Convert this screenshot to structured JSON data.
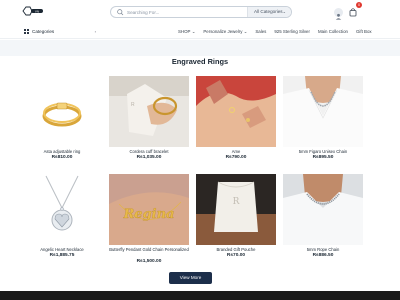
{
  "header": {
    "logo_text": "VN",
    "search": {
      "placeholder": "Searching For...",
      "category_label": "All Categories"
    },
    "cart_count": "0"
  },
  "nav": {
    "categories_label": "Categories",
    "links": [
      {
        "label": "SHOP",
        "has_dropdown": true
      },
      {
        "label": "Personalize Jewelry",
        "has_dropdown": true
      },
      {
        "label": "Sales",
        "has_dropdown": false
      },
      {
        "label": "925 Sterling Silver",
        "has_dropdown": false
      },
      {
        "label": "Main Collection",
        "has_dropdown": false
      },
      {
        "label": "Gift Box",
        "has_dropdown": false
      }
    ]
  },
  "section": {
    "title": "Engraved Rings"
  },
  "products": [
    {
      "name": "Asta adjustable ring",
      "price": "Rs810.00",
      "image": "gold-ring-product"
    },
    {
      "name": "Cordera cuff bracelet",
      "price": "Rs1,035.00",
      "image": "hand-cuff-bracelet-photo"
    },
    {
      "name": "Ame",
      "price": "Rs790.00",
      "image": "hands-rings-photo"
    },
    {
      "name": "5mm Figaro Unisex Chain",
      "price": "Rs895.50",
      "image": "neck-chain-photo"
    },
    {
      "name": "Angelic Heart Necklace",
      "price": "Rs1,885.75",
      "image": "heart-pendant-product"
    },
    {
      "name": "Butterfly Pendant Gold Chain Personalized",
      "price": "Rs1,500.00",
      "image": "name-necklace-photo"
    },
    {
      "name": "Branded Gift Pouche",
      "price": "Rs70.00",
      "image": "gift-pouch-photo"
    },
    {
      "name": "5mm Rope Chain",
      "price": "Rs886.50",
      "image": "rope-chain-photo"
    }
  ],
  "name_necklace_text": "Regina",
  "pouch_logo_text": "R",
  "view_more_label": "View More",
  "colors": {
    "primary_button": "#1c2e4a",
    "badge": "#e0382f",
    "gold": "#d4a437"
  }
}
